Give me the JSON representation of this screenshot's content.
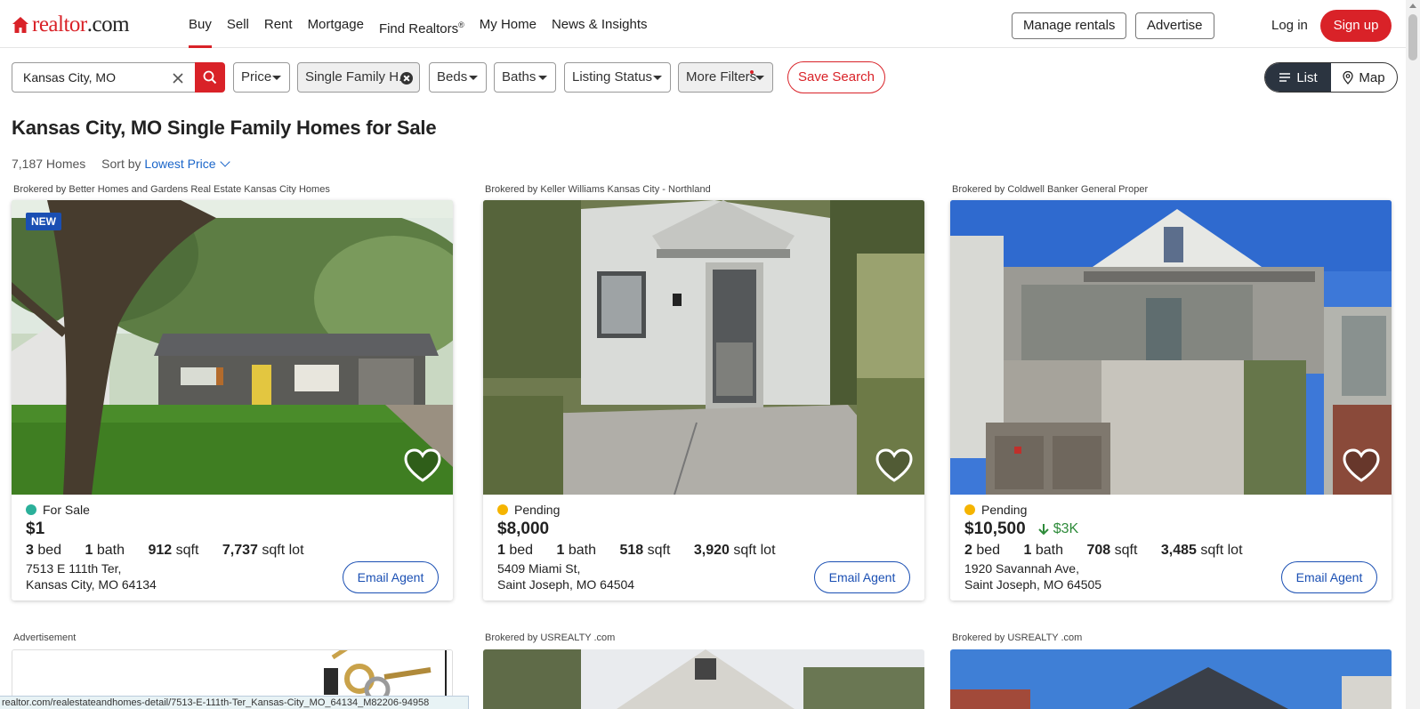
{
  "brand": {
    "logo_main": "realtor",
    "logo_suffix": ".com",
    "accent": "#d92228"
  },
  "nav": [
    {
      "label": "Buy"
    },
    {
      "label": "Sell"
    },
    {
      "label": "Rent"
    },
    {
      "label": "Mortgage"
    },
    {
      "label": "Find Realtors",
      "sup": "®"
    },
    {
      "label": "My Home"
    },
    {
      "label": "News & Insights"
    }
  ],
  "header": {
    "manage_rentals": "Manage rentals",
    "advertise": "Advertise",
    "login": "Log in",
    "signup": "Sign up"
  },
  "filters": {
    "search_value": "Kansas City, MO",
    "price": "Price",
    "home_type": "Single Family H...",
    "beds": "Beds",
    "baths": "Baths",
    "listing_status": "Listing Status",
    "more_filters": "More Filters",
    "save_search": "Save Search",
    "view_list": "List",
    "view_map": "Map"
  },
  "results": {
    "title": "Kansas City, MO Single Family Homes for Sale",
    "count": "7,187 Homes",
    "sort_label": "Sort by",
    "sort_value": "Lowest Price"
  },
  "listings": [
    {
      "broker": "Brokered by Better Homes and Gardens Real Estate Kansas City Homes",
      "badge": "NEW",
      "status": "For Sale",
      "status_color": "#2bb09a",
      "price": "$1",
      "price_drop": "",
      "beds": "3",
      "beds_unit": "bed",
      "baths": "1",
      "baths_unit": "bath",
      "sqft": "912",
      "sqft_unit": "sqft",
      "lot": "7,737",
      "lot_unit": "sqft lot",
      "addr1": "7513 E 111th Ter,",
      "addr2": "Kansas City, MO 64134",
      "cta": "Email Agent"
    },
    {
      "broker": "Brokered by Keller Williams Kansas City - Northland",
      "badge": "",
      "status": "Pending",
      "status_color": "#f5b400",
      "price": "$8,000",
      "price_drop": "",
      "beds": "1",
      "beds_unit": "bed",
      "baths": "1",
      "baths_unit": "bath",
      "sqft": "518",
      "sqft_unit": "sqft",
      "lot": "3,920",
      "lot_unit": "sqft lot",
      "addr1": "5409 Miami St,",
      "addr2": "Saint Joseph, MO 64504",
      "cta": "Email Agent"
    },
    {
      "broker": "Brokered by Coldwell Banker General Proper",
      "badge": "",
      "status": "Pending",
      "status_color": "#f5b400",
      "price": "$10,500",
      "price_drop": "$3K",
      "beds": "2",
      "beds_unit": "bed",
      "baths": "1",
      "baths_unit": "bath",
      "sqft": "708",
      "sqft_unit": "sqft",
      "lot": "3,485",
      "lot_unit": "sqft lot",
      "addr1": "1920 Savannah Ave,",
      "addr2": "Saint Joseph, MO 64505",
      "cta": "Email Agent"
    }
  ],
  "row2": {
    "ad_label": "Advertisement",
    "broker2": "Brokered by USREALTY .com",
    "broker3": "Brokered by USREALTY .com"
  },
  "status_url": "realtor.com/realestateandhomes-detail/7513-E-111th-Ter_Kansas-City_MO_64134_M82206-94958"
}
